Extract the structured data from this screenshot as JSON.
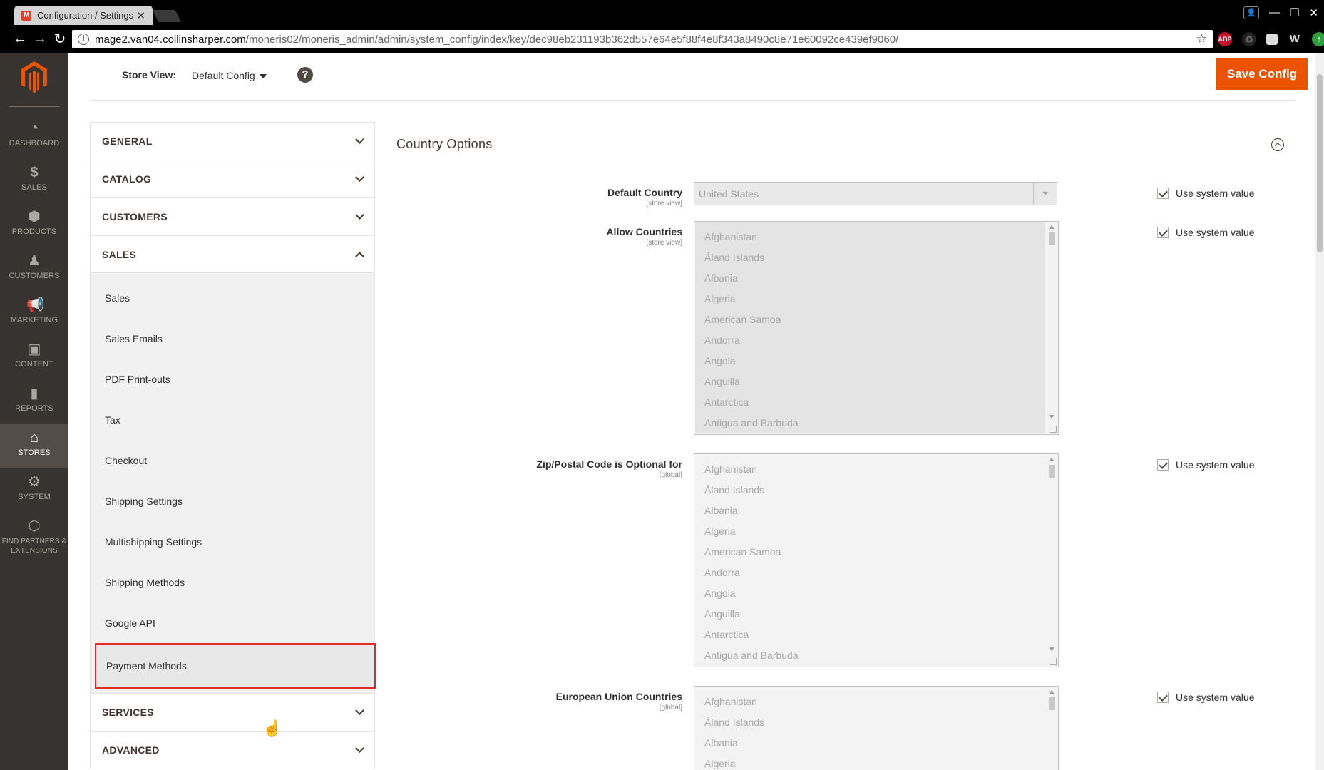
{
  "browser": {
    "tab_title": "Configuration / Settings",
    "tab_close": "✕",
    "url_host": "mage2.van04.collinsharper.com",
    "url_path": "/moneris02/moneris_admin/admin/system_config/index/key/dec98eb231193b362d557e64e5f88f4e8f343a8490c8e71e60092ce439ef9060/"
  },
  "leftnav": {
    "items": [
      {
        "label": "Dashboard",
        "icon": "dashboard-icon"
      },
      {
        "label": "Sales",
        "icon": "dollar-icon"
      },
      {
        "label": "Products",
        "icon": "box-icon"
      },
      {
        "label": "Customers",
        "icon": "person-icon"
      },
      {
        "label": "Marketing",
        "icon": "megaphone-icon"
      },
      {
        "label": "Content",
        "icon": "layout-icon"
      },
      {
        "label": "Reports",
        "icon": "bar-chart-icon"
      },
      {
        "label": "Stores",
        "icon": "store-icon"
      },
      {
        "label": "System",
        "icon": "gear-icon"
      },
      {
        "label": "Find Partners & Extensions",
        "icon": "cube-icon"
      }
    ],
    "active": "Stores"
  },
  "pagebar": {
    "store_view_label": "Store View:",
    "store_view_value": "Default Config",
    "help": "?",
    "save_label": "Save Config"
  },
  "config_tabs": {
    "general": "GENERAL",
    "catalog": "CATALOG",
    "customers": "CUSTOMERS",
    "sales": "SALES",
    "sales_items": [
      "Sales",
      "Sales Emails",
      "PDF Print-outs",
      "Tax",
      "Checkout",
      "Shipping Settings",
      "Multishipping Settings",
      "Shipping Methods",
      "Google API",
      "Payment Methods"
    ],
    "services": "SERVICES",
    "advanced": "ADVANCED"
  },
  "section": {
    "title": "Country Options",
    "use_system_value": "Use system value",
    "default_country": {
      "label": "Default Country",
      "scope": "[store view]",
      "value": "United States"
    },
    "allow_countries": {
      "label": "Allow Countries",
      "scope": "[store view]"
    },
    "zip_optional": {
      "label": "Zip/Postal Code is Optional for",
      "scope": "[global]"
    },
    "eu_countries": {
      "label": "European Union Countries",
      "scope": "[global]"
    },
    "countries": [
      "Afghanistan",
      "Åland Islands",
      "Albania",
      "Algeria",
      "American Samoa",
      "Andorra",
      "Angola",
      "Anguilla",
      "Antarctica",
      "Antigua and Barbuda"
    ]
  },
  "colors": {
    "accent": "#eb5202",
    "nav_bg": "#373330",
    "highlight": "#e02b27"
  }
}
